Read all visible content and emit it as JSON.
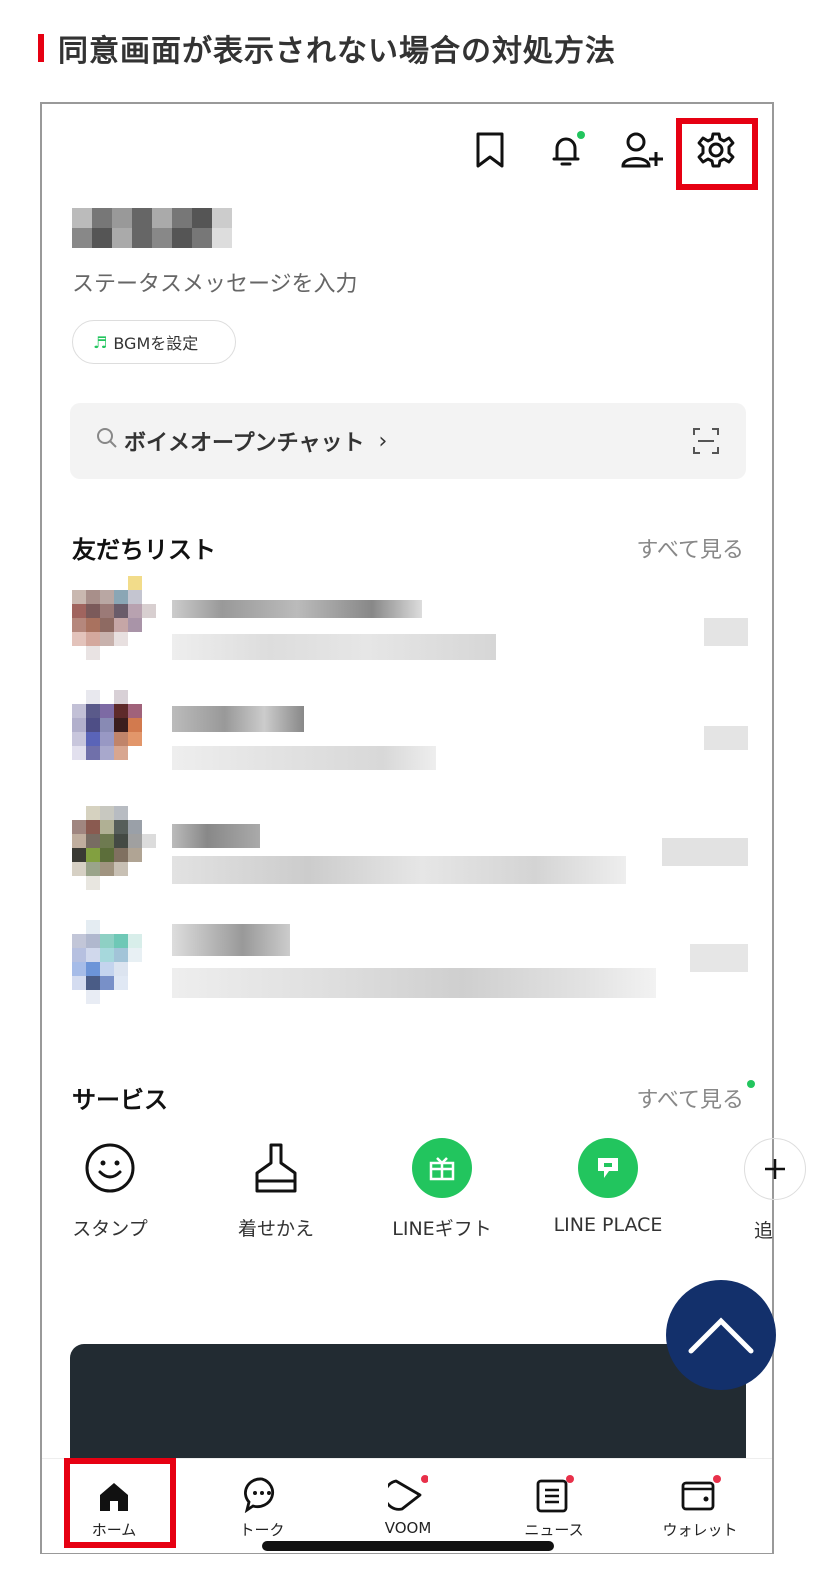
{
  "heading": "同意画面が表示されない場合の対処方法",
  "header_icons": [
    "bookmark-icon",
    "bell-icon",
    "add-friend-icon",
    "gear-icon"
  ],
  "profile": {
    "status_placeholder": "ステータスメッセージを入力",
    "bgm_label": "BGMを設定"
  },
  "search": {
    "label": "ボイメオープンチャット",
    "chevron": "›"
  },
  "friends": {
    "title": "友だちリスト",
    "see_all": "すべて見る"
  },
  "services": {
    "title": "サービス",
    "see_all": "すべて見る",
    "items": [
      {
        "label": "スタンプ",
        "icon": "smile-icon"
      },
      {
        "label": "着せかえ",
        "icon": "brush-icon"
      },
      {
        "label": "LINEギフト",
        "icon": "gift-icon"
      },
      {
        "label": "LINE PLACE",
        "icon": "place-icon"
      },
      {
        "label": "追",
        "icon": "add-icon"
      }
    ]
  },
  "tabs": [
    {
      "label": "ホーム",
      "icon": "home-icon"
    },
    {
      "label": "トーク",
      "icon": "chat-icon"
    },
    {
      "label": "VOOM",
      "icon": "voom-icon"
    },
    {
      "label": "ニュース",
      "icon": "news-icon"
    },
    {
      "label": "ウォレット",
      "icon": "wallet-icon"
    }
  ],
  "colors": {
    "highlight": "#e60012",
    "line_green": "#22c55e",
    "scroll_button": "#13306b",
    "badge_red": "#e8304a"
  }
}
